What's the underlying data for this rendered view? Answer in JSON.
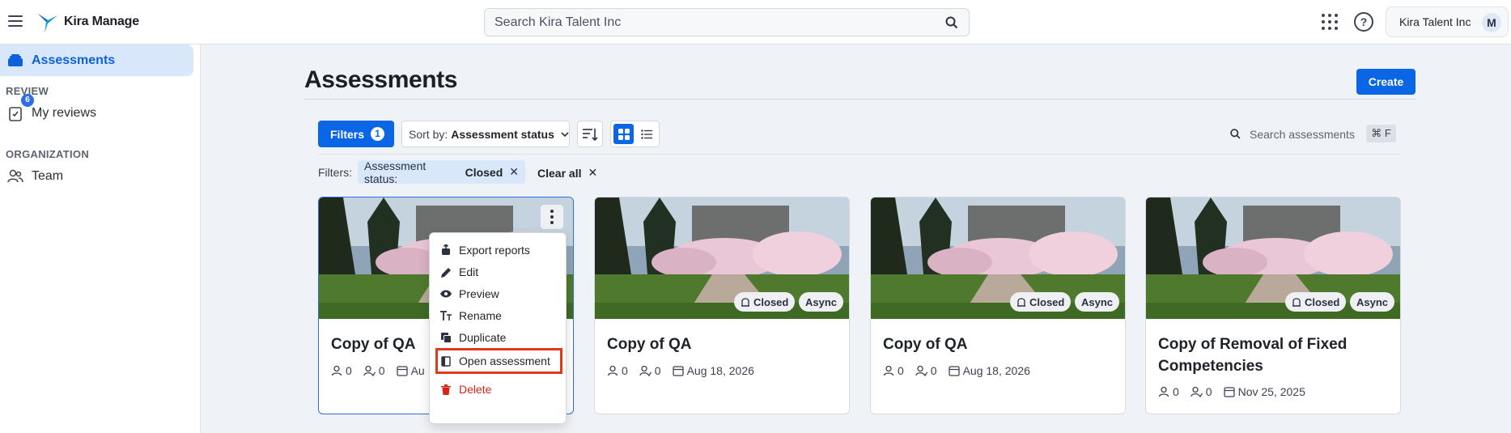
{
  "header": {
    "app_name": "Kira Manage",
    "search_placeholder": "Search Kira Talent Inc",
    "org_name": "Kira Talent Inc",
    "avatar_initial": "M"
  },
  "sidebar": {
    "active_item": "Assessments",
    "review_heading": "REVIEW",
    "reviews_label": "My reviews",
    "reviews_badge": "6",
    "org_heading": "ORGANIZATION",
    "team_label": "Team"
  },
  "main": {
    "title": "Assessments",
    "create_label": "Create",
    "filters_label": "Filters",
    "filters_count": "1",
    "sort_prefix": "Sort by:",
    "sort_value": "Assessment status",
    "search_placeholder": "Search assessments",
    "search_shortcut": "⌘ F",
    "active_filters_label": "Filters:",
    "chip_key": "Assessment status:",
    "chip_value": "Closed",
    "clear_all_label": "Clear all"
  },
  "cards": [
    {
      "title": "Copy of QA",
      "participants": "0",
      "reviewers": "0",
      "date": "Au"
    },
    {
      "title": "Copy of QA",
      "participants": "0",
      "reviewers": "0",
      "date": "Aug 18, 2026",
      "status": "Closed",
      "type": "Async"
    },
    {
      "title": "Copy of QA",
      "participants": "0",
      "reviewers": "0",
      "date": "Aug 18, 2026",
      "status": "Closed",
      "type": "Async"
    },
    {
      "title": "Copy of Removal of Fixed Competencies",
      "participants": "0",
      "reviewers": "0",
      "date": "Nov 25, 2025",
      "status": "Closed",
      "type": "Async"
    }
  ],
  "context_menu": {
    "items": [
      "Export reports",
      "Edit",
      "Preview",
      "Rename",
      "Duplicate",
      "Open assessment",
      "Delete"
    ]
  },
  "colors": {
    "accent": "#0a66e4",
    "danger": "#d62518",
    "highlight_box": "#e2381b"
  }
}
